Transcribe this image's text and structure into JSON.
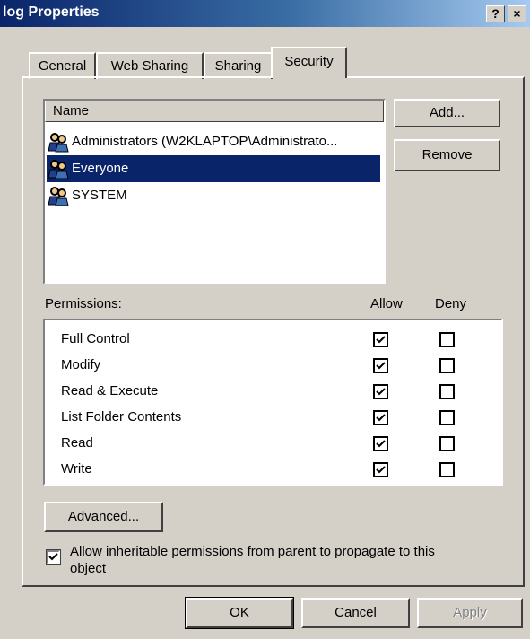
{
  "window": {
    "title": "log Properties",
    "help_label": "?",
    "close_label": "×"
  },
  "tabs": [
    {
      "label": "General"
    },
    {
      "label": "Web Sharing"
    },
    {
      "label": "Sharing"
    },
    {
      "label": "Security",
      "active": true
    }
  ],
  "names_list": {
    "header": "Name",
    "items": [
      {
        "label": "Administrators (W2KLAPTOP\\Administrato...",
        "selected": false
      },
      {
        "label": "Everyone",
        "selected": true
      },
      {
        "label": "SYSTEM",
        "selected": false
      }
    ]
  },
  "buttons": {
    "add": "Add...",
    "remove": "Remove",
    "advanced": "Advanced...",
    "ok": "OK",
    "cancel": "Cancel",
    "apply": "Apply"
  },
  "permissions": {
    "label": "Permissions:",
    "allow_header": "Allow",
    "deny_header": "Deny",
    "items": [
      {
        "name": "Full Control",
        "allow": true,
        "deny": false
      },
      {
        "name": "Modify",
        "allow": true,
        "deny": false
      },
      {
        "name": "Read & Execute",
        "allow": true,
        "deny": false
      },
      {
        "name": "List Folder Contents",
        "allow": true,
        "deny": false
      },
      {
        "name": "Read",
        "allow": true,
        "deny": false
      },
      {
        "name": "Write",
        "allow": true,
        "deny": false
      }
    ]
  },
  "inherit": {
    "checked": true,
    "line1": "Allow inheritable permissions from parent to propagate to this",
    "line2": "object"
  },
  "colors": {
    "title_start": "#0a246a",
    "title_end": "#a6caf0",
    "selection": "#0a246a",
    "face": "#d4d0c8"
  }
}
